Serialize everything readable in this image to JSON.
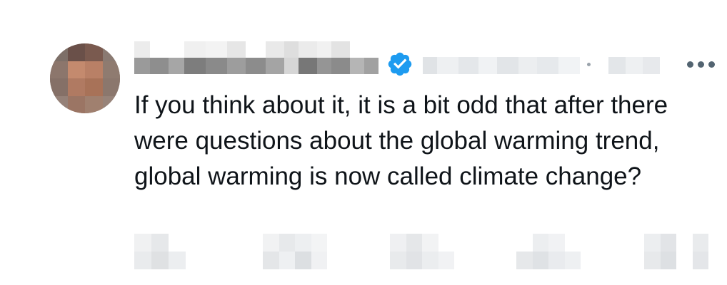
{
  "tweet": {
    "text": "If you think about it, it is a bit odd that after there were questions about the global warming trend, global warming is now called climate change?",
    "verified": true
  },
  "icons": {
    "avatar": "redacted-avatar",
    "verified": "verified-badge-icon",
    "more": "more-options-icon",
    "actions": [
      "reply-icon",
      "retweet-icon",
      "like-icon",
      "views-icon",
      "share-icon"
    ]
  },
  "colors": {
    "text": "#0f1419",
    "verified": "#1d9bf0",
    "muted": "#536471",
    "background": "#ffffff"
  }
}
